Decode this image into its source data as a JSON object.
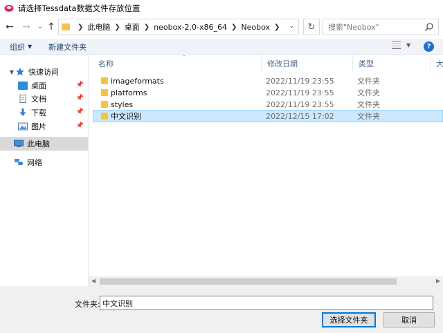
{
  "window": {
    "title": "请选择Tessdata数据文件存放位置"
  },
  "address": {
    "breadcrumbs": [
      "此电脑",
      "桌面",
      "neobox-2.0-x86_64",
      "Neobox"
    ]
  },
  "search": {
    "placeholder": "搜索\"Neobox\""
  },
  "toolbar": {
    "organize_label": "组织",
    "new_folder_label": "新建文件夹"
  },
  "sidebar": {
    "items": [
      {
        "label": "快速访问",
        "icon": "star-icon"
      },
      {
        "label": "桌面",
        "icon": "desktop-icon"
      },
      {
        "label": "文档",
        "icon": "document-icon"
      },
      {
        "label": "下载",
        "icon": "download-icon"
      },
      {
        "label": "图片",
        "icon": "picture-icon"
      },
      {
        "label": "此电脑",
        "icon": "computer-icon"
      },
      {
        "label": "网络",
        "icon": "network-icon"
      }
    ]
  },
  "table": {
    "columns": [
      "名称",
      "修改日期",
      "类型",
      "大小"
    ],
    "rows": [
      {
        "name": "imageformats",
        "date": "2022/11/19 23:55",
        "type": "文件夹"
      },
      {
        "name": "platforms",
        "date": "2022/11/19 23:55",
        "type": "文件夹"
      },
      {
        "name": "styles",
        "date": "2022/11/19 23:55",
        "type": "文件夹"
      },
      {
        "name": "中文识别",
        "date": "2022/12/15 17:02",
        "type": "文件夹"
      }
    ]
  },
  "footer": {
    "filename_label": "文件夹:",
    "filename_value": "中文识别",
    "select_label": "选择文件夹",
    "cancel_label": "取消"
  },
  "colors": {
    "accent": "#0078d7",
    "folder": "#f5c343",
    "selection": "#cce8ff"
  }
}
